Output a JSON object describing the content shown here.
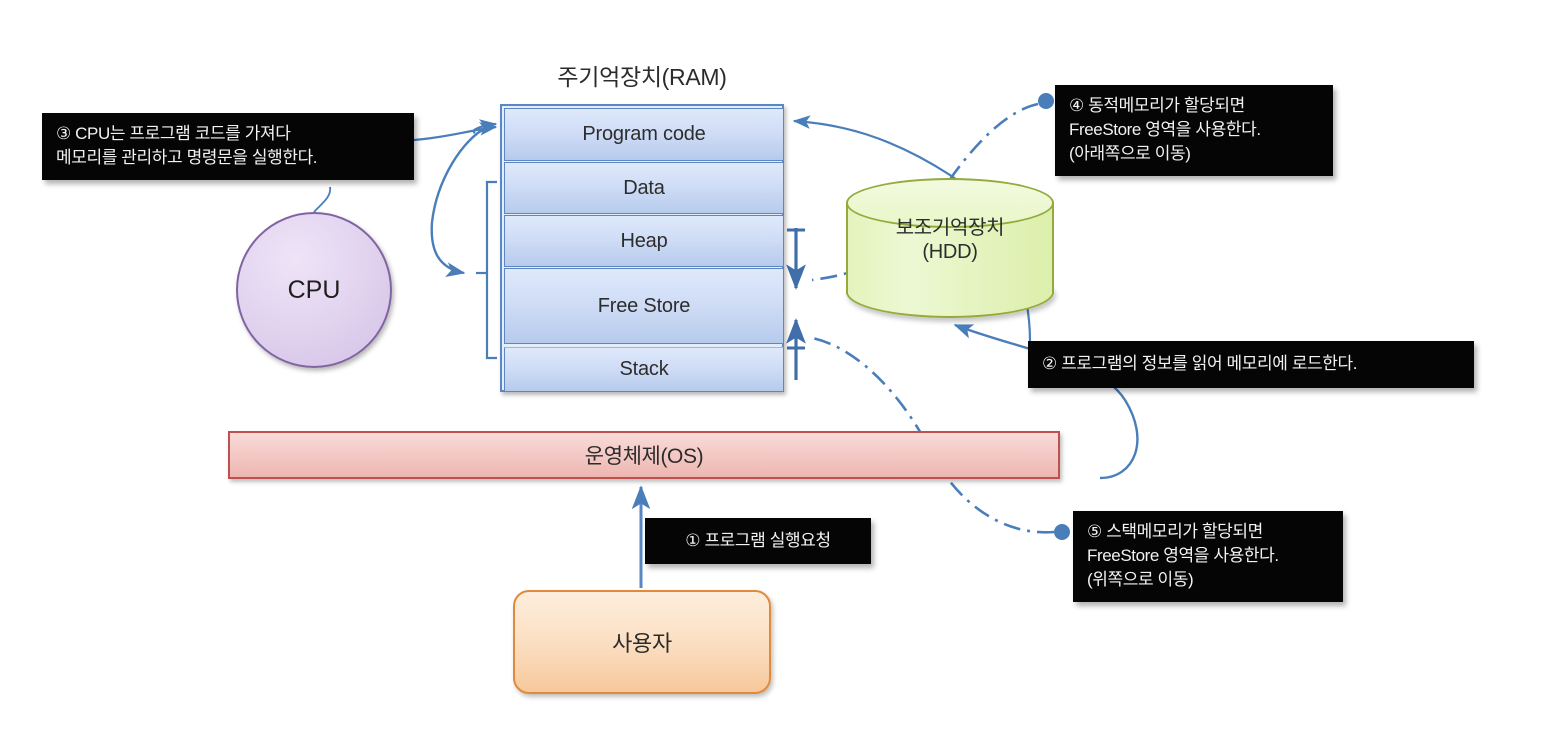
{
  "diagram": {
    "title_ram": "주기억장치(RAM)",
    "memory_segments": [
      {
        "id": "program-code",
        "label": "Program code"
      },
      {
        "id": "data",
        "label": "Data"
      },
      {
        "id": "heap",
        "label": "Heap"
      },
      {
        "id": "free-store",
        "label": "Free Store"
      },
      {
        "id": "stack",
        "label": "Stack"
      }
    ],
    "cpu": {
      "label": "CPU"
    },
    "hdd": {
      "label_line1": "보조기억장치",
      "label_line2": "(HDD)"
    },
    "os": {
      "label": "운영체제(OS)"
    },
    "user": {
      "label": "사용자"
    },
    "callouts": {
      "step1": "① 프로그램 실행요청",
      "step2": "② 프로그램의 정보를 읽어 메모리에 로드한다.",
      "step3": "③ CPU는 프로그램 코드를 가져다\n메모리를 관리하고 명령문을 실행한다.",
      "step4": "④ 동적메모리가 할당되면\nFreeStore 영역을 사용한다.\n(아래쪽으로 이동)",
      "step5": "⑤ 스택메모리가 할당되면\nFreeStore 영역을 사용한다.\n(위쪽으로 이동)"
    },
    "colors": {
      "connector_blue": "#4a7ebb",
      "memory_border": "#5c87c2",
      "memory_fill_top": "#dfe9fb",
      "memory_fill_bottom": "#b6cbec",
      "cpu_border": "#8064a2",
      "cpu_fill": "#e3d5f0",
      "hdd_border": "#94ab3c",
      "hdd_fill": "#e4f3bd",
      "os_border": "#c0504d",
      "os_fill": "#f4cbc7",
      "user_border": "#e08a3c",
      "user_fill": "#fbdfc3",
      "callout_background": "#050505",
      "callout_text": "#f2f2f2"
    }
  }
}
